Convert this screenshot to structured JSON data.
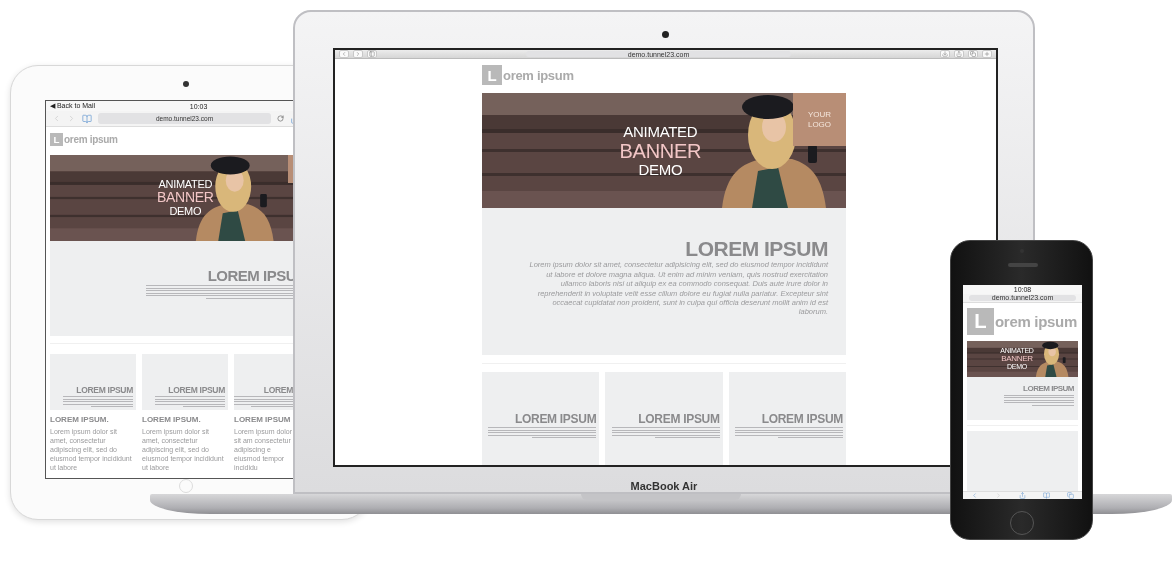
{
  "tablet": {
    "status": {
      "back": "◀ Back to Mail",
      "time": "10:03"
    },
    "url": "demo.tunnel23.com",
    "logo": {
      "letter": "L",
      "text": "orem ipsum"
    },
    "banner": {
      "lines": [
        "ANIMATED",
        "BANNER",
        "DEMO"
      ]
    },
    "hero": {
      "title": "LOREM IPSU"
    },
    "cards": [
      {
        "title": "LOREM IPSUM",
        "heading": "LOREM IPSUM.",
        "body": "Lorem ipsum dolor sit amet, consectetur adipiscing elit, sed do eiusmod tempor incididunt ut labore"
      },
      {
        "title": "LOREM IPSUM",
        "heading": "LOREM IPSUM.",
        "body": "Lorem ipsum dolor sit amet, consectetur adipiscing elit, sed do eiusmod tempor incididunt ut labore"
      },
      {
        "title": "LOREM",
        "heading": "LOREM IPSUM",
        "body": "Lorem ipsum dolor sit am consectetur adipiscing e eiusmod tempor incididu"
      }
    ]
  },
  "laptop": {
    "url": "demo.tunnel23.com",
    "logo": {
      "letter": "L",
      "text": "orem ipsum"
    },
    "banner": {
      "lines": [
        "ANIMATED",
        "BANNER",
        "DEMO"
      ],
      "logo_lines": [
        "YOUR",
        "LOGO"
      ]
    },
    "hero": {
      "title": "LOREM IPSUM",
      "text": "Lorem ipsum dolor sit amet, consectetur adipisicing elit, sed do eiusmod tempor incididunt ut labore et dolore magna aliqua. Ut enim ad minim veniam, quis nostrud exercitation ullamco laboris nisi ut aliquip ex ea commodo consequat. Duis aute irure dolor in reprehenderit in voluptate velit esse cillum dolore eu fugiat nulla pariatur. Excepteur sint occaecat cupidatat non proident, sunt in culpa qui officia deserunt mollit anim id est laborum."
    },
    "cards": [
      {
        "title": "LOREM IPSUM"
      },
      {
        "title": "LOREM IPSUM"
      },
      {
        "title": "LOREM IPSUM"
      }
    ],
    "brand": "MacBook Air"
  },
  "phone": {
    "time": "10:08",
    "url": "demo.tunnel23.com",
    "logo": {
      "letter": "L",
      "text": "orem ipsum"
    },
    "banner": {
      "lines": [
        "ANIMATED",
        "BANNER",
        "DEMO"
      ]
    },
    "hero": {
      "title": "LOREM IPSUM"
    }
  }
}
